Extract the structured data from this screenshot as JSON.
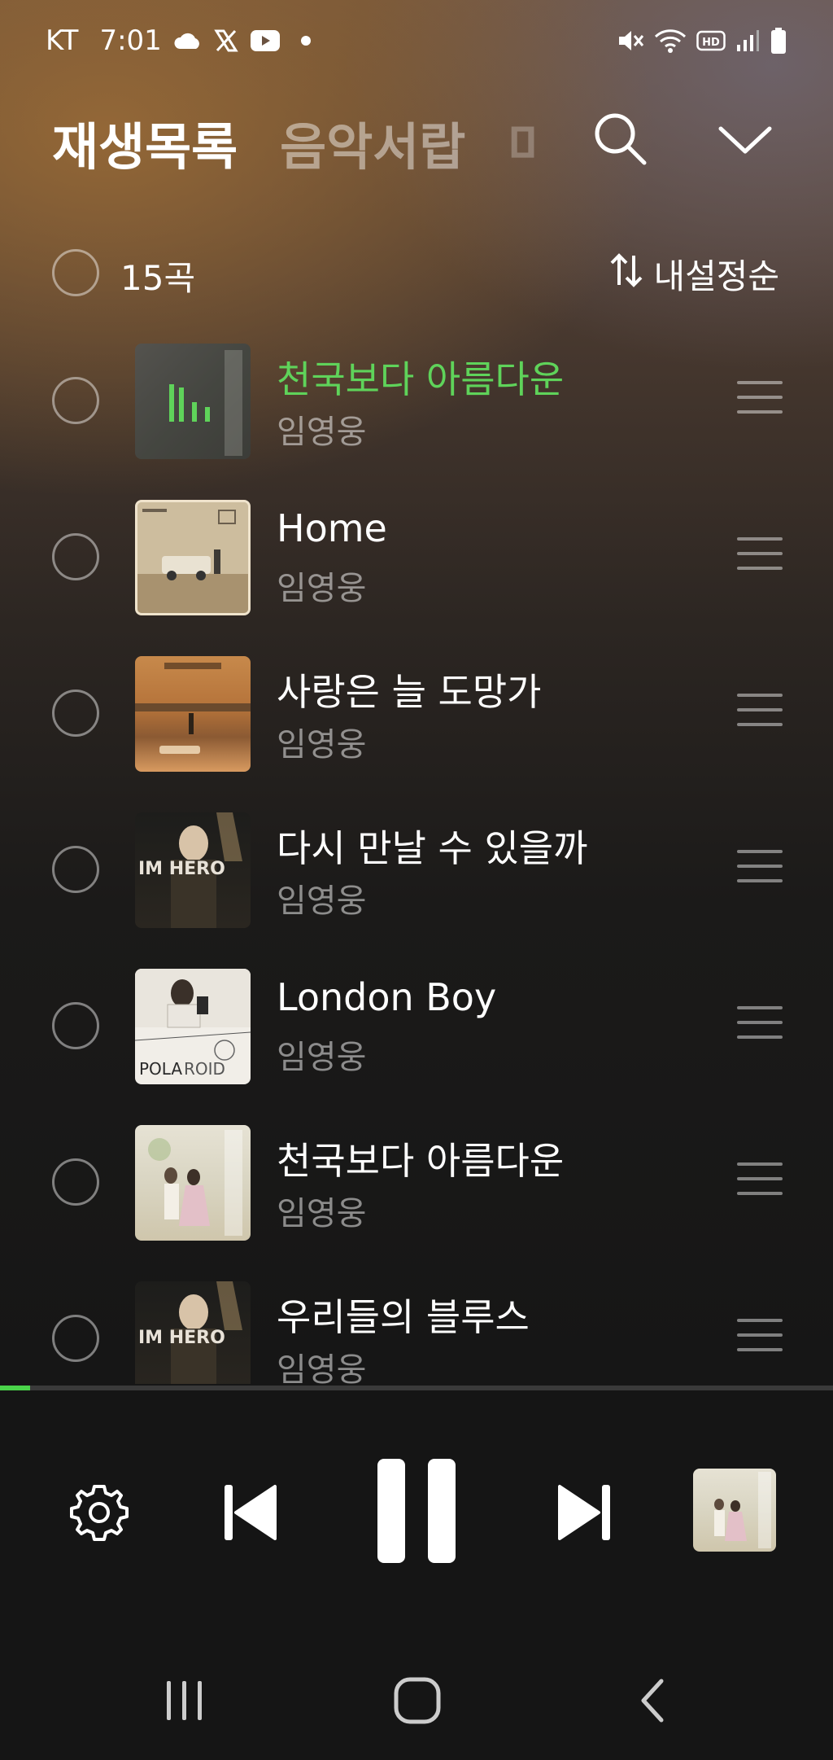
{
  "status_bar": {
    "carrier": "KT",
    "time": "7:01",
    "icons_left": [
      "cloud-icon",
      "x-icon",
      "youtube-icon",
      "dot-icon"
    ],
    "icons_right": [
      "mute-icon",
      "wifi-icon",
      "hd-icon",
      "signal-icon",
      "battery-icon"
    ]
  },
  "header": {
    "tabs": [
      {
        "label": "재생목록",
        "active": true
      },
      {
        "label": "음악서랍",
        "active": false
      },
      {
        "label": "마",
        "active": false
      }
    ]
  },
  "list_header": {
    "count": "15곡",
    "sort_label": "내설정순"
  },
  "songs": [
    {
      "title": "천국보다 아름다운",
      "artist": "임영웅",
      "playing": true,
      "art": "art-heaven-playing"
    },
    {
      "title": "Home",
      "artist": "임영웅",
      "playing": false,
      "art": "art-home"
    },
    {
      "title": "사랑은 늘 도망가",
      "artist": "임영웅",
      "playing": false,
      "art": "art-love-runs"
    },
    {
      "title": "다시 만날 수 있을까",
      "artist": "임영웅",
      "playing": false,
      "art": "art-im-hero"
    },
    {
      "title": "London Boy",
      "artist": "임영웅",
      "playing": false,
      "art": "art-polaroid"
    },
    {
      "title": "천국보다 아름다운",
      "artist": "임영웅",
      "playing": false,
      "art": "art-heaven"
    },
    {
      "title": "우리들의 블루스",
      "artist": "임영웅",
      "playing": false,
      "art": "art-im-hero"
    }
  ],
  "album_text": {
    "im_hero": "IM HERO",
    "polaroid_a": "POLA",
    "polaroid_b": "ROID"
  },
  "progress": {
    "fraction": 0.036
  },
  "player": {
    "icons": [
      "settings-icon",
      "previous-icon",
      "pause-icon",
      "next-icon"
    ],
    "thumb_art": "art-heaven"
  },
  "nav_bar": {
    "icons": [
      "recents-icon",
      "home-icon",
      "back-icon"
    ]
  },
  "colors": {
    "accent": "#5fd35a",
    "progress": "#4ad34a"
  }
}
